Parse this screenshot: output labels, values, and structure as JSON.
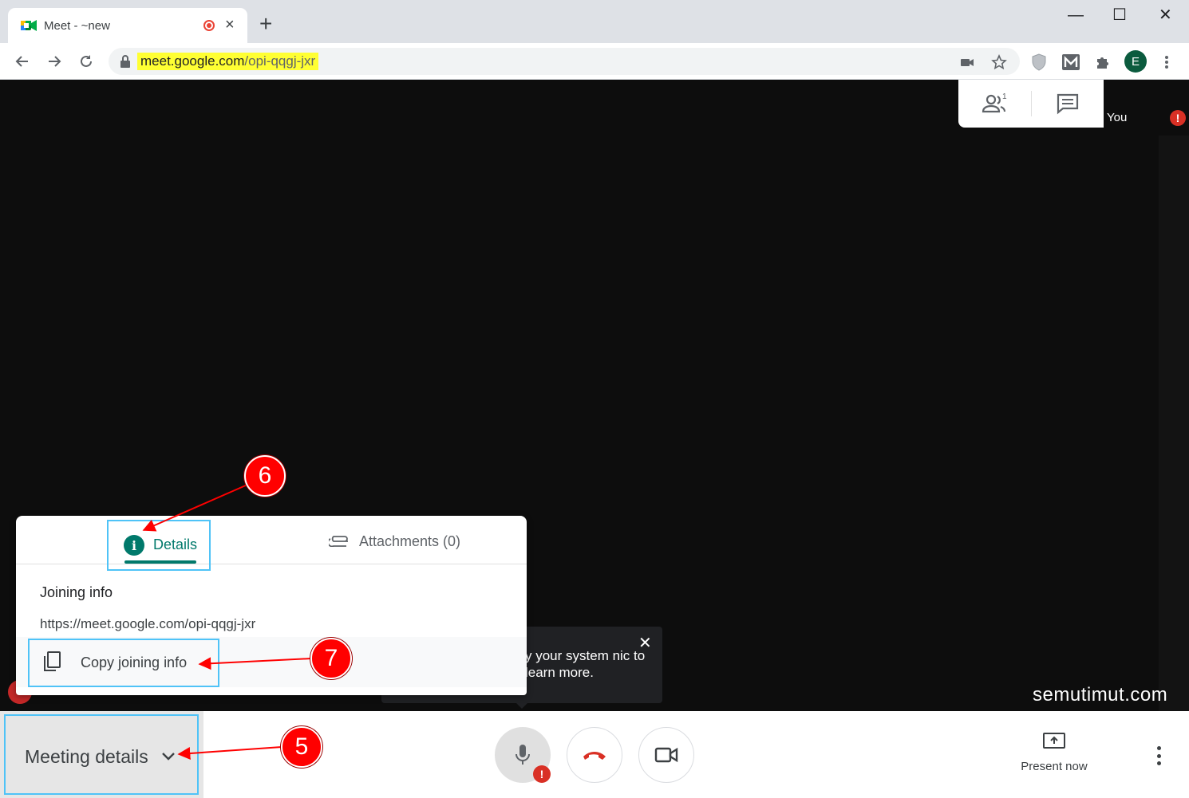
{
  "browser": {
    "tab_title": "Meet - ~new",
    "tab_close": "×",
    "new_tab": "+",
    "window": {
      "minimize": "—",
      "maximize": "☐",
      "close": "✕"
    },
    "url_host": "meet.google.com",
    "url_path": "/opi-qqgj-jxr",
    "avatar_initial": "E"
  },
  "meet": {
    "side_panel": {
      "participants_count": "1"
    },
    "self_label": "You",
    "alert_mark": "!",
    "toast": {
      "text": "y your system nic to learn more.",
      "close": "✕"
    },
    "popup": {
      "tab_details": "Details",
      "tab_attachments": "Attachments (0)",
      "joining_title": "Joining info",
      "joining_url": "https://meet.google.com/opi-qqgj-jxr",
      "copy_label": "Copy joining info"
    },
    "bottombar": {
      "meeting_details": "Meeting details",
      "present_now": "Present now"
    },
    "watermark": "semutimut.com"
  },
  "annotations": {
    "step_5": "5",
    "step_6": "6",
    "step_7": "7",
    "marker_color": "#ff0000",
    "highlight_color": "#4fc3f7"
  },
  "colors": {
    "meet_teal": "#00796b",
    "alert_red": "#d93025",
    "url_highlight": "#ffff33"
  }
}
